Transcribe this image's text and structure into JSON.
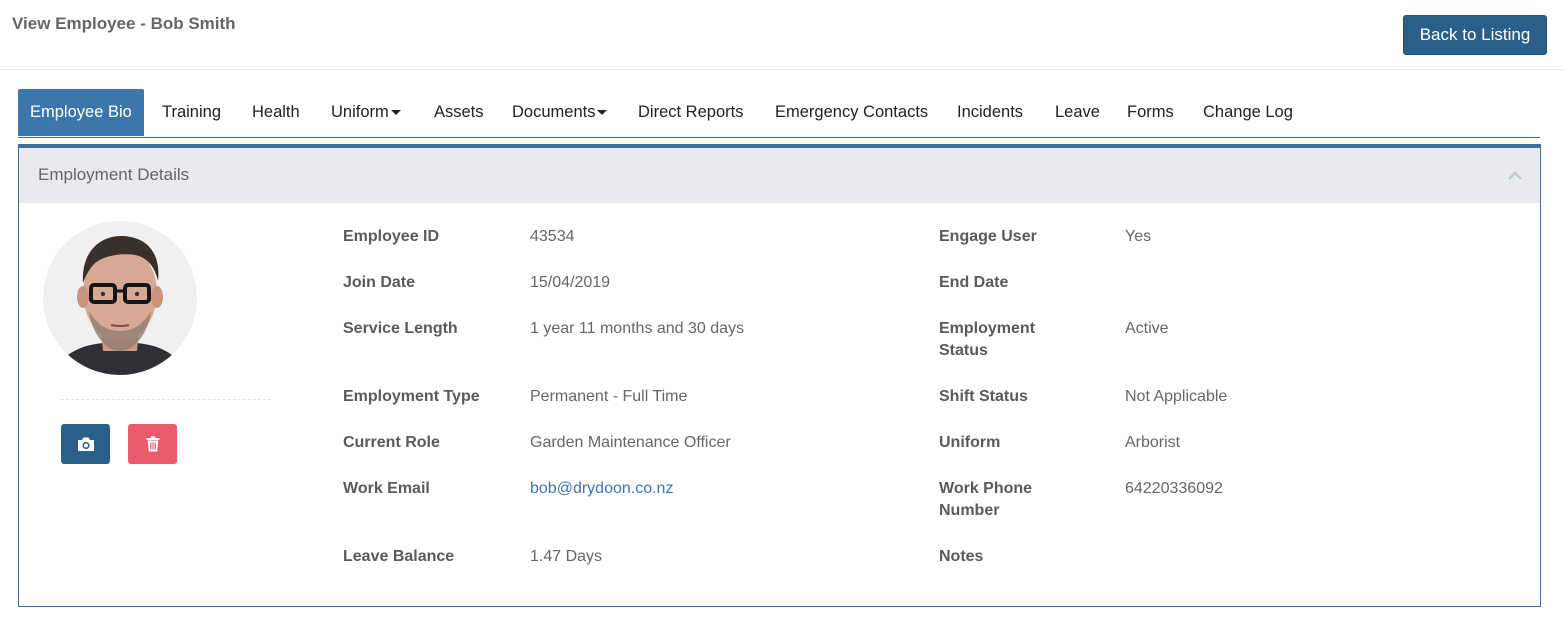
{
  "header": {
    "title": "View Employee - Bob Smith",
    "back_button": "Back to Listing"
  },
  "tabs": [
    {
      "label": "Employee Bio",
      "active": true
    },
    {
      "label": "Training"
    },
    {
      "label": "Health"
    },
    {
      "label": "Uniform",
      "dropdown": true
    },
    {
      "label": "Assets"
    },
    {
      "label": "Documents",
      "dropdown": true
    },
    {
      "label": "Direct Reports"
    },
    {
      "label": "Emergency Contacts"
    },
    {
      "label": "Incidents"
    },
    {
      "label": "Leave"
    },
    {
      "label": "Forms"
    },
    {
      "label": "Change Log"
    }
  ],
  "panel": {
    "title": "Employment Details",
    "collapse_icon": "chevron-up-icon",
    "photo_buttons": {
      "camera_icon": "camera-icon",
      "delete_icon": "trash-icon"
    }
  },
  "details_left": [
    {
      "label": "Employee ID",
      "value": "43534"
    },
    {
      "label": "Join Date",
      "value": "15/04/2019"
    },
    {
      "label": "Service Length",
      "value": "1 year 11 months and 30 days"
    },
    {
      "label": "Employment Type",
      "value": "Permanent - Full Time"
    },
    {
      "label": "Current Role",
      "value": "Garden Maintenance Officer"
    },
    {
      "label": "Work Email",
      "value": "bob@drydoon.co.nz"
    },
    {
      "label": "Leave Balance",
      "value": "1.47 Days"
    }
  ],
  "details_right": [
    {
      "label": "Engage User",
      "value": "Yes"
    },
    {
      "label": "End Date",
      "value": ""
    },
    {
      "label_line1": "Employment",
      "label_line2": "Status",
      "value": "Active"
    },
    {
      "label": "Shift Status",
      "value": "Not Applicable"
    },
    {
      "label": "Uniform",
      "value": "Arborist"
    },
    {
      "label_line1": "Work Phone",
      "label_line2": "Number",
      "value": "64220336092"
    },
    {
      "label": "Notes",
      "value": ""
    }
  ],
  "colors": {
    "primary": "#2c5e8a",
    "tab_active": "#3c76ad",
    "danger": "#ea5a6d",
    "panel_header": "#e8eaed",
    "link": "#3c76ad"
  }
}
